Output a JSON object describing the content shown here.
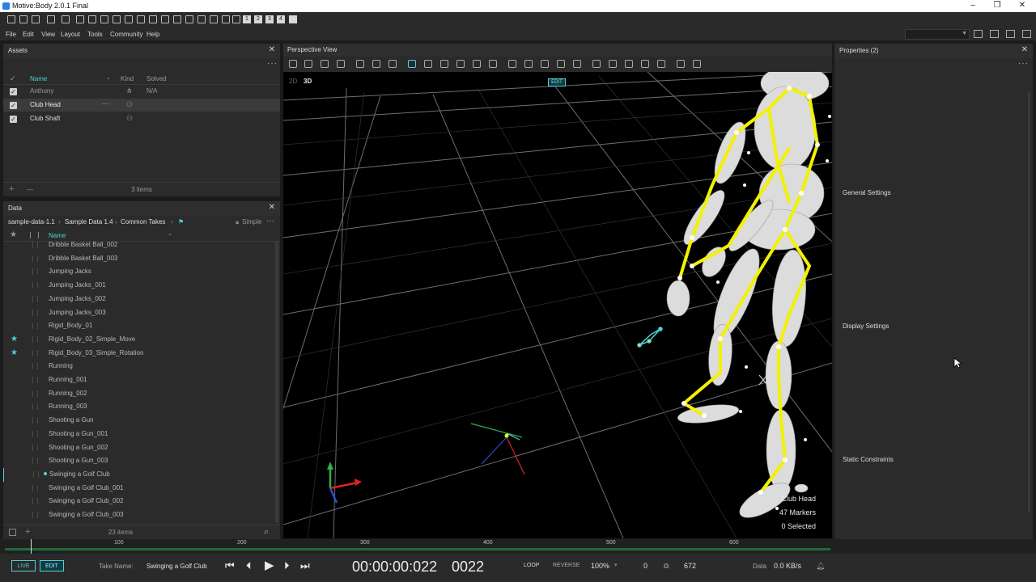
{
  "window": {
    "title": "Motive:Body 2.0.1 Final",
    "minimize": "–",
    "restore": "❐",
    "close": "✕"
  },
  "menu": [
    "File",
    "Edit",
    "View",
    "Layout",
    "Tools",
    "Community",
    "Help"
  ],
  "toolbar_numbers": [
    "1",
    "2",
    "3",
    "4"
  ],
  "assets": {
    "title": "Assets",
    "close": "✕",
    "columns": {
      "name": "Name",
      "kind": "Kind",
      "solved": "Solved"
    },
    "rows": [
      {
        "name": "Anthony",
        "solved": "N/A"
      },
      {
        "name": "Club Head",
        "solved": ""
      },
      {
        "name": "Club Shaft",
        "solved": ""
      }
    ],
    "count": "3 items",
    "add": "+",
    "remove": "—"
  },
  "data_panel": {
    "title": "Data",
    "close": "✕",
    "breadcrumb": [
      "sample-data-1.1",
      "Sample Data 1.4",
      "Common Takes"
    ],
    "view_mode": "Simple",
    "column_name": "Name",
    "takes": [
      {
        "name": "Dribble Basket Ball_002",
        "starred": false
      },
      {
        "name": "Dribble Basket Ball_003",
        "starred": false
      },
      {
        "name": "Jumping Jacks",
        "starred": false
      },
      {
        "name": "Jumping Jacks_001",
        "starred": false
      },
      {
        "name": "Jumping Jacks_002",
        "starred": false
      },
      {
        "name": "Jumping Jacks_003",
        "starred": false
      },
      {
        "name": "Rigid_Body_01",
        "starred": false
      },
      {
        "name": "Rigid_Body_02_Simple_Move",
        "starred": true
      },
      {
        "name": "Rigid_Body_03_Simple_Rotation",
        "starred": true
      },
      {
        "name": "Running",
        "starred": false
      },
      {
        "name": "Running_001",
        "starred": false
      },
      {
        "name": "Running_002",
        "starred": false
      },
      {
        "name": "Running_003",
        "starred": false
      },
      {
        "name": "Shooting a Gun",
        "starred": false
      },
      {
        "name": "Shooting a Gun_001",
        "starred": false
      },
      {
        "name": "Shooting a Gun_002",
        "starred": false
      },
      {
        "name": "Shooting a Gun_003",
        "starred": false
      },
      {
        "name": "Swinging a Golf Club",
        "starred": false,
        "active": true
      },
      {
        "name": "Swinging a Golf Club_001",
        "starred": false
      },
      {
        "name": "Swinging a Golf Club_002",
        "starred": false
      },
      {
        "name": "Swinging a Golf Club_003",
        "starred": false
      }
    ],
    "count": "23 items"
  },
  "viewport": {
    "title": "Perspective View",
    "mode_2d": "2D",
    "mode_3d": "3D",
    "edit_badge": "EDIT",
    "info": {
      "asset": "Club Head",
      "markers": "47 Markers",
      "selected": "0 Selected"
    }
  },
  "properties": {
    "title": "Properties (2)",
    "close": "✕",
    "sections": [
      "General Settings",
      "Display Settings",
      "Static Constraints"
    ]
  },
  "timeline": {
    "ticks": [
      "100",
      "200",
      "300",
      "400",
      "500",
      "600"
    ]
  },
  "transport": {
    "live": "LIVE",
    "edit": "EDIT",
    "take_label": "Take Name:",
    "take_name": "Swinging a Golf Club",
    "timecode": "00:00:00:022",
    "frame": "0022",
    "loop": "LOOP",
    "reverse": "REVERSE",
    "speed": "100%",
    "range_start": "0",
    "range_end": "672",
    "data_label": "Data",
    "data_rate": "0.0 KB/s",
    "btn_first": "⏮",
    "btn_prev": "⏴",
    "btn_play": "▶",
    "btn_next": "⏵",
    "btn_last": "⏭"
  },
  "colors": {
    "accent": "#4fd1d9",
    "bone": "#f2f200",
    "background": "#000000",
    "panel": "#2b2b2b"
  }
}
